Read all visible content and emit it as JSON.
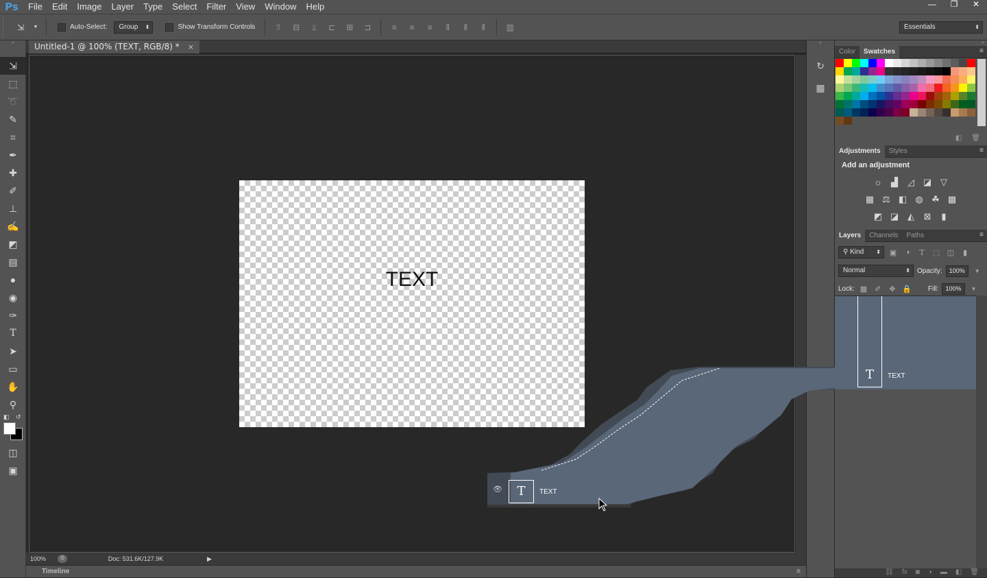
{
  "app": {
    "logo": "Ps"
  },
  "menu": [
    "File",
    "Edit",
    "Image",
    "Layer",
    "Type",
    "Select",
    "Filter",
    "View",
    "Window",
    "Help"
  ],
  "window_controls": {
    "minimize": "—",
    "restore": "❐",
    "close": "✕"
  },
  "options_bar": {
    "auto_select_label": "Auto-Select:",
    "auto_select_value": "Group",
    "show_transform_label": "Show Transform Controls",
    "workspace": "Essentials"
  },
  "document": {
    "tab_title": "Untitled-1 @ 100% (TEXT, RGB/8) *",
    "close": "×",
    "canvas_text": "TEXT",
    "zoom": "100%",
    "doc_info": "Doc: 531.6K/127.9K"
  },
  "timeline": {
    "label": "Timeline"
  },
  "panels": {
    "color_tabs": [
      "Color",
      "Swatches"
    ],
    "active_color_tab": "Swatches",
    "adjustment_tabs": [
      "Adjustments",
      "Styles"
    ],
    "adjustments_title": "Add an adjustment",
    "layer_tabs": [
      "Layers",
      "Channels",
      "Paths"
    ],
    "filter_kind": "Kind",
    "blend_mode": "Normal",
    "opacity_label": "Opacity:",
    "opacity_value": "100%",
    "lock_label": "Lock:",
    "fill_label": "Fill:",
    "fill_value": "100%"
  },
  "layers": [
    {
      "name": "TEXT",
      "type": "text",
      "visible": true
    }
  ],
  "drag_ghost": {
    "layer_name": "TEXT"
  },
  "swatch_colors": [
    "#ff0000",
    "#ffff00",
    "#00ff00",
    "#00ffff",
    "#0000ff",
    "#ff00ff",
    "#ffffff",
    "#ebebeb",
    "#d6d6d6",
    "#c2c2c2",
    "#adadad",
    "#999999",
    "#858585",
    "#707070",
    "#5c5c5c",
    "#474747",
    "#ff0000",
    "#ffd700",
    "#00a650",
    "#00a99d",
    "#2e3192",
    "#92278f",
    "#ec008c",
    "#333333",
    "#2b2b2b",
    "#262626",
    "#1f1f1f",
    "#1a1a1a",
    "#141414",
    "#0d0d0d",
    "#000000",
    "#f7977a",
    "#f9ad81",
    "#fdc68a",
    "#fff79a",
    "#c4df9b",
    "#a3d39c",
    "#82ca9d",
    "#7bcdc8",
    "#6ecff6",
    "#7ea7d8",
    "#8493ca",
    "#8882be",
    "#a187be",
    "#bc8dbf",
    "#f49ac2",
    "#f6989d",
    "#f26c4f",
    "#f68e55",
    "#fbaf5c",
    "#fff467",
    "#acd372",
    "#7cc576",
    "#3bb878",
    "#1abbb4",
    "#00bff3",
    "#438ccb",
    "#5574b9",
    "#605ca8",
    "#855fa8",
    "#a763a8",
    "#f06ea9",
    "#f26d7d",
    "#ed1c24",
    "#f26522",
    "#f7941d",
    "#fff200",
    "#8dc73f",
    "#39b54a",
    "#00a651",
    "#00a99d",
    "#00aeef",
    "#0072bc",
    "#0054a6",
    "#2e3192",
    "#662d91",
    "#92278f",
    "#ec008c",
    "#ed145b",
    "#9e0b0f",
    "#a0410d",
    "#a36209",
    "#aba000",
    "#598527",
    "#197b30",
    "#007236",
    "#00746b",
    "#0076a3",
    "#004b80",
    "#003471",
    "#1b1464",
    "#440e62",
    "#630460",
    "#9e005d",
    "#9e0039",
    "#790000",
    "#7b2e00",
    "#7d4900",
    "#827b00",
    "#406618",
    "#005e20",
    "#005826",
    "#005952",
    "#005b7f",
    "#003663",
    "#002157",
    "#0d004c",
    "#32004b",
    "#4b0049",
    "#7b0046",
    "#7a0026",
    "#c7b299",
    "#998675",
    "#736357",
    "#534741",
    "#362f2d",
    "#c69c6d",
    "#a67c52",
    "#8c6239",
    "#754c24",
    "#603913"
  ]
}
